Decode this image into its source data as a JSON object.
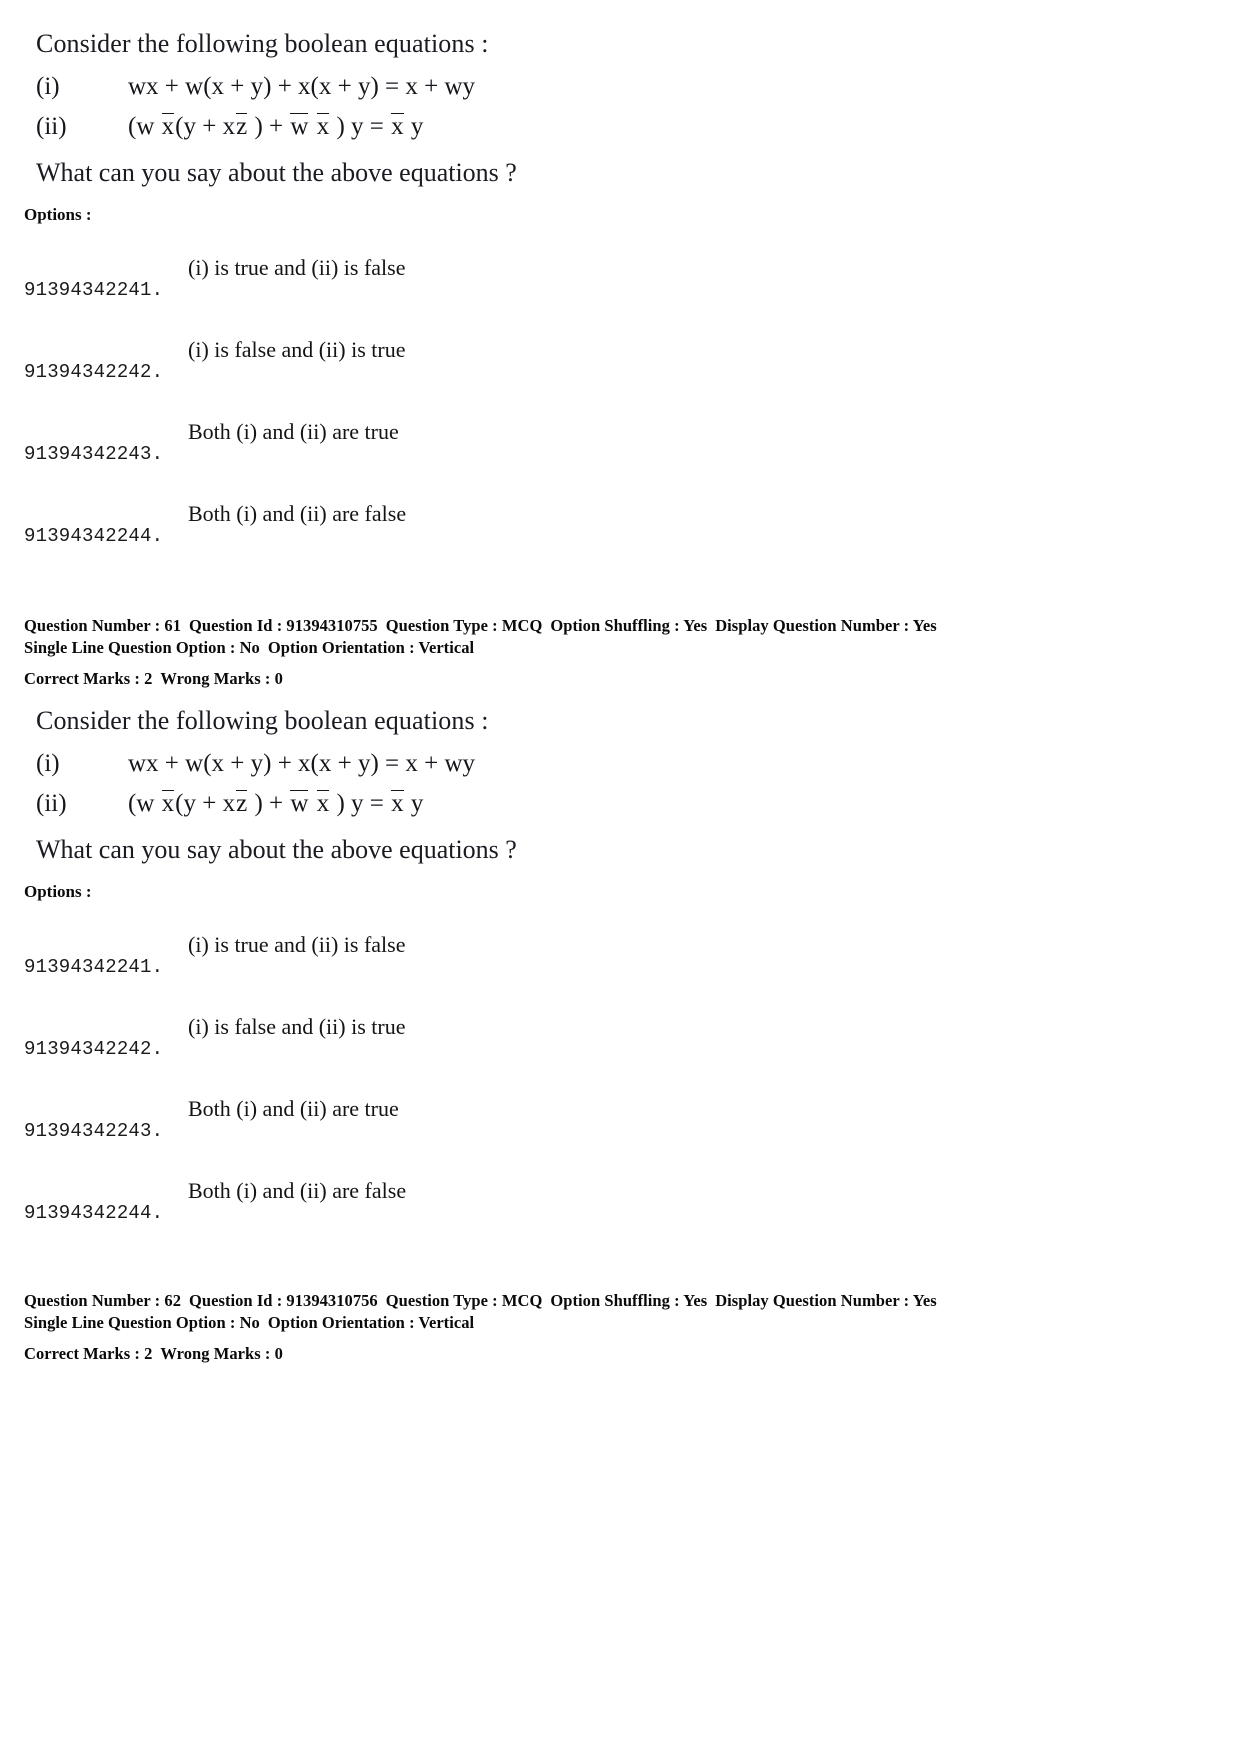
{
  "document": {
    "type": "exam-question-paper",
    "background_color": "#ffffff",
    "text_color": "#111111"
  },
  "questions": [
    {
      "stem": "Consider the following boolean equations :",
      "equations": [
        {
          "label": "(i)",
          "plain": "wx + w(x + y) + x(x + y) = x + wy",
          "parts": [
            {
              "text": "wx + w(x + y) + x(x + y) = x + wy",
              "overline": false
            }
          ]
        },
        {
          "label": "(ii)",
          "plain": "(w x̄ (y + x z̄ ) + w̄ x̄ ) y = x̄ y",
          "parts": [
            {
              "text": "(w ",
              "overline": false
            },
            {
              "text": "x",
              "overline": true
            },
            {
              "text": "(y + x",
              "overline": false
            },
            {
              "text": "z",
              "overline": true
            },
            {
              "text": " ) + ",
              "overline": false
            },
            {
              "text": "w",
              "overline": true
            },
            {
              "text": " ",
              "overline": false
            },
            {
              "text": "x",
              "overline": true
            },
            {
              "text": " ) y = ",
              "overline": false
            },
            {
              "text": "x",
              "overline": true
            },
            {
              "text": " y",
              "overline": false
            }
          ]
        }
      ],
      "closing": "What can you say about the above equations ?",
      "options_label": "Options :",
      "options": [
        {
          "id": "91394342241.",
          "text": "(i) is true and (ii) is false"
        },
        {
          "id": "91394342242.",
          "text": "(i) is false and (ii) is true"
        },
        {
          "id": "91394342243.",
          "text": "Both (i) and (ii) are true"
        },
        {
          "id": "91394342244.",
          "text": "Both (i) and (ii) are false"
        }
      ]
    },
    {
      "stem": "Consider the following boolean equations :",
      "equations": [
        {
          "label": "(i)",
          "plain": "wx + w(x + y) + x(x + y) = x + wy",
          "parts": [
            {
              "text": "wx + w(x + y) + x(x + y) = x + wy",
              "overline": false
            }
          ]
        },
        {
          "label": "(ii)",
          "plain": "(w x̄ (y + x z̄ ) + w̄ x̄ ) y = x̄ y",
          "parts": [
            {
              "text": "(w ",
              "overline": false
            },
            {
              "text": "x",
              "overline": true
            },
            {
              "text": "(y + x",
              "overline": false
            },
            {
              "text": "z",
              "overline": true
            },
            {
              "text": " ) + ",
              "overline": false
            },
            {
              "text": "w",
              "overline": true
            },
            {
              "text": " ",
              "overline": false
            },
            {
              "text": "x",
              "overline": true
            },
            {
              "text": " ) y = ",
              "overline": false
            },
            {
              "text": "x",
              "overline": true
            },
            {
              "text": " y",
              "overline": false
            }
          ]
        }
      ],
      "closing": "What can you say about the above equations ?",
      "options_label": "Options :",
      "options": [
        {
          "id": "91394342241.",
          "text": "(i) is true and (ii) is false"
        },
        {
          "id": "91394342242.",
          "text": "(i) is false and (ii) is true"
        },
        {
          "id": "91394342243.",
          "text": "Both (i) and (ii) are true"
        },
        {
          "id": "91394342244.",
          "text": "Both (i) and (ii) are false"
        }
      ]
    }
  ],
  "metadata_blocks": [
    {
      "question_number_label": "Question Number : 61",
      "question_id_label": "Question Id : 91394310755",
      "question_type_label": "Question Type : MCQ",
      "option_shuffling_label": "Option Shuffling : Yes",
      "display_question_number_label": "Display Question Number : Yes",
      "single_line_option_label": "Single Line Question Option : No",
      "option_orientation_label": "Option Orientation : Vertical",
      "correct_marks_label": "Correct Marks : 2",
      "wrong_marks_label": "Wrong Marks : 0"
    },
    {
      "question_number_label": "Question Number : 62",
      "question_id_label": "Question Id : 91394310756",
      "question_type_label": "Question Type : MCQ",
      "option_shuffling_label": "Option Shuffling : Yes",
      "display_question_number_label": "Display Question Number : Yes",
      "single_line_option_label": "Single Line Question Option : No",
      "option_orientation_label": "Option Orientation : Vertical",
      "correct_marks_label": "Correct Marks : 2",
      "wrong_marks_label": "Wrong Marks : 0"
    }
  ]
}
